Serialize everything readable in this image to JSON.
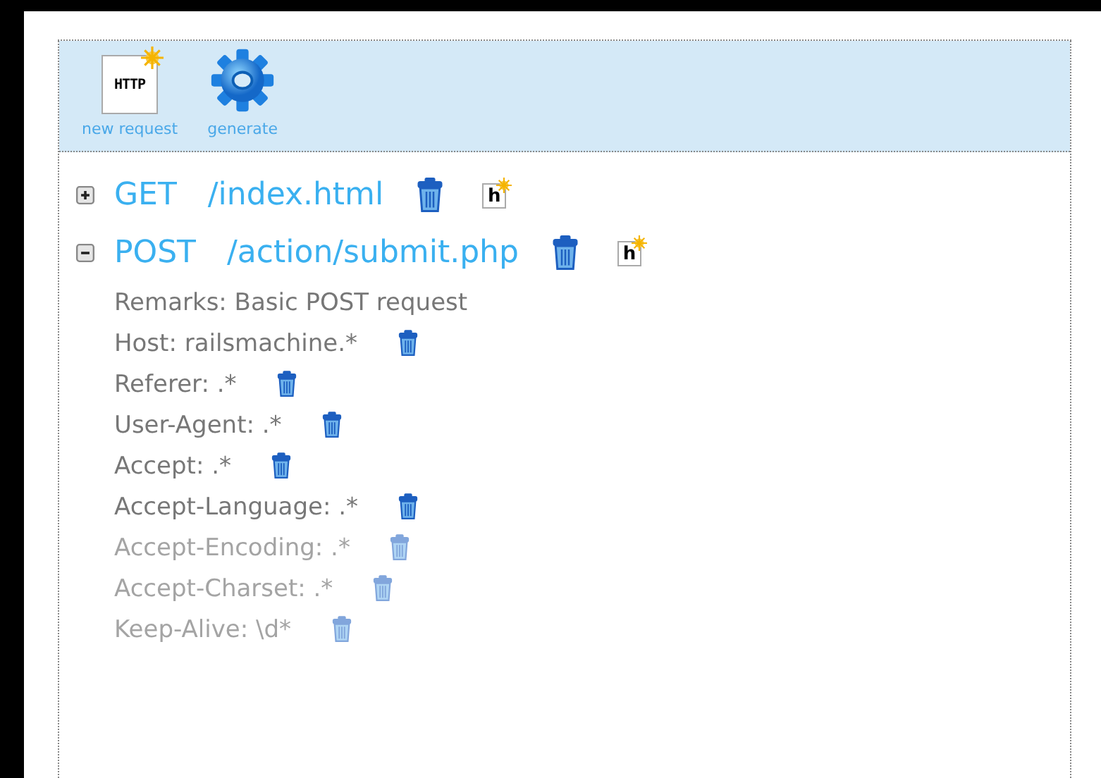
{
  "toolbar": [
    {
      "kind": "http",
      "label": "new request",
      "icon_text": "HTTP"
    },
    {
      "kind": "gear",
      "label": "generate"
    }
  ],
  "requests": [
    {
      "method": "GET",
      "path": "/index.html",
      "expanded": false,
      "badge": "h"
    },
    {
      "method": "POST",
      "path": "/action/submit.php",
      "expanded": true,
      "badge": "h",
      "remarks": "Remarks: Basic POST request",
      "headers": [
        {
          "text": "Host: railsmachine.*",
          "disabled": false
        },
        {
          "text": "Referer: .*",
          "disabled": false
        },
        {
          "text": "User-Agent: .*",
          "disabled": false
        },
        {
          "text": "Accept: .*",
          "disabled": false
        },
        {
          "text": "Accept-Language: .*",
          "disabled": false
        },
        {
          "text": "Accept-Encoding: .*",
          "disabled": true
        },
        {
          "text": "Accept-Charset: .*",
          "disabled": true
        },
        {
          "text": "Keep-Alive: \\d*",
          "disabled": true
        }
      ]
    }
  ]
}
